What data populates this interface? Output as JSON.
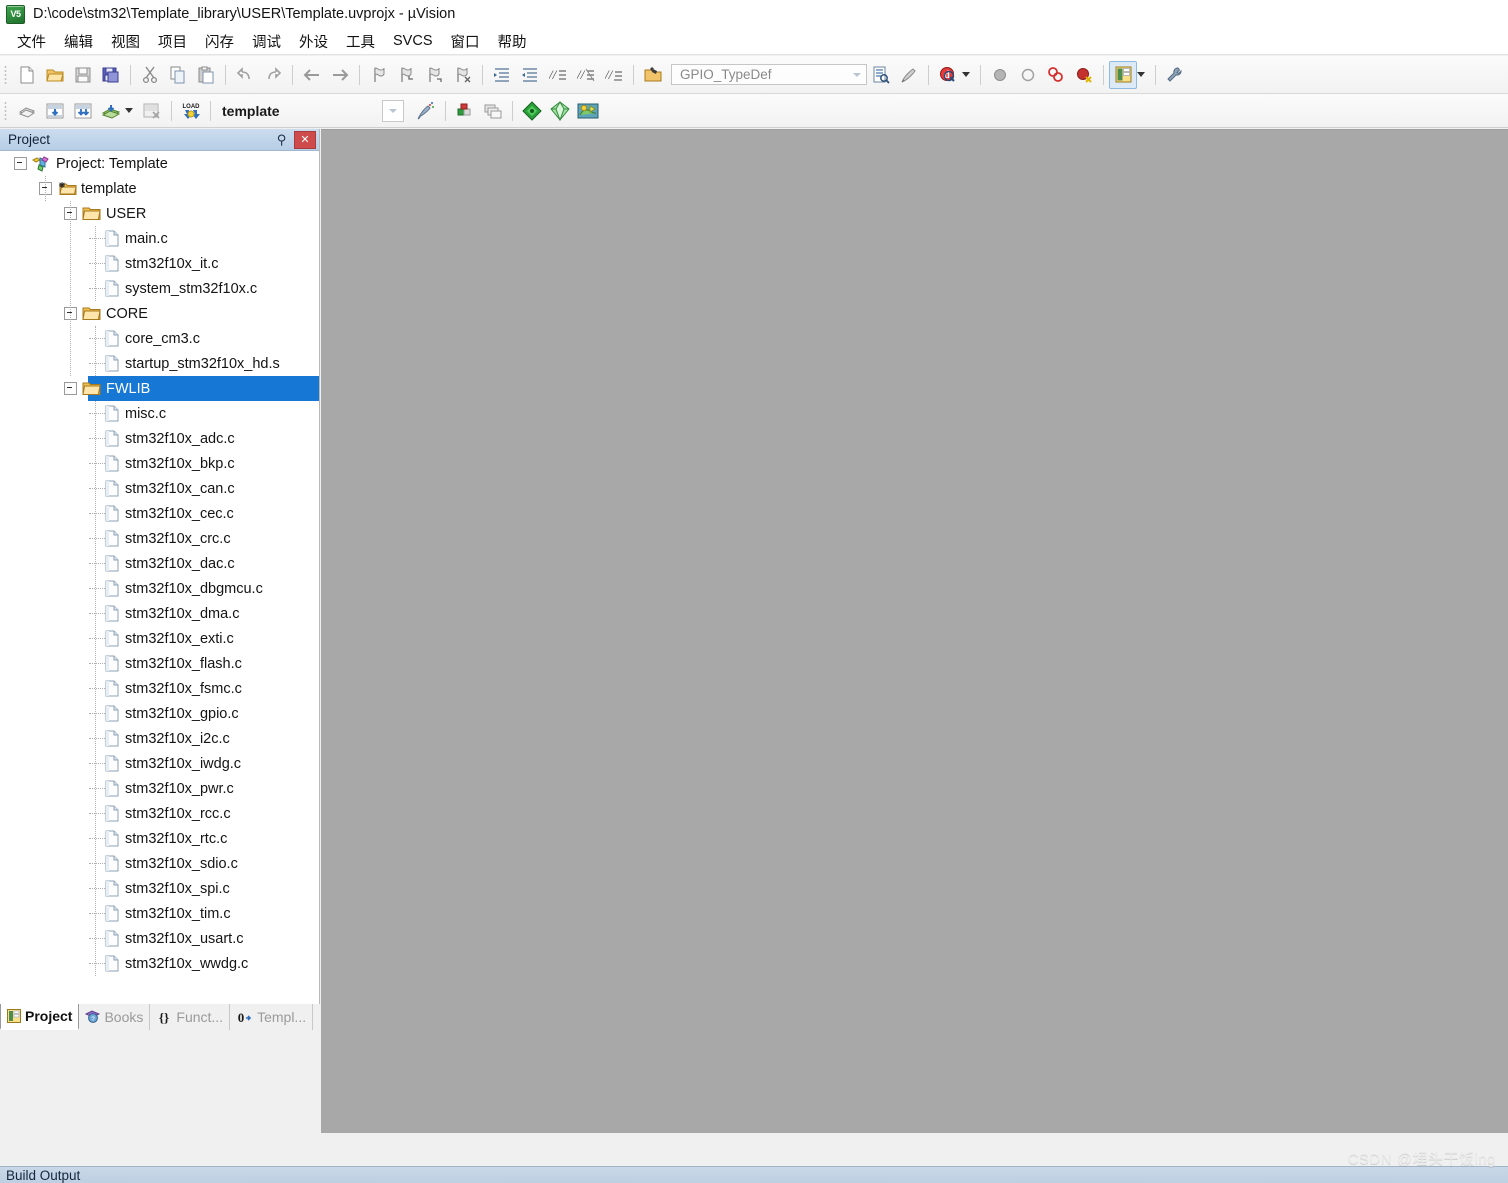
{
  "window": {
    "title": "D:\\code\\stm32\\Template_library\\USER\\Template.uvprojx - µVision",
    "app_icon_label": "V5"
  },
  "menubar": {
    "items": [
      {
        "label": "文件"
      },
      {
        "label": "编辑"
      },
      {
        "label": "视图"
      },
      {
        "label": "项目"
      },
      {
        "label": "闪存"
      },
      {
        "label": "调试"
      },
      {
        "label": "外设"
      },
      {
        "label": "工具"
      },
      {
        "label": "SVCS"
      },
      {
        "label": "窗口"
      },
      {
        "label": "帮助"
      }
    ]
  },
  "toolbar_main": {
    "symbol_combo_value": "GPIO_TypeDef"
  },
  "toolbar_build": {
    "target_value": "template"
  },
  "project_panel": {
    "title": "Project",
    "pin_glyph": "⚲",
    "close_glyph": "✕",
    "tree": [
      {
        "label": "Project: Template",
        "type": "project",
        "depth": 0,
        "expanded": true,
        "selected": false
      },
      {
        "label": "template",
        "type": "target",
        "depth": 1,
        "expanded": true,
        "selected": false
      },
      {
        "label": "USER",
        "type": "folder",
        "depth": 2,
        "expanded": true,
        "selected": false
      },
      {
        "label": "main.c",
        "type": "file",
        "depth": 3,
        "expanded": false,
        "selected": false
      },
      {
        "label": "stm32f10x_it.c",
        "type": "file",
        "depth": 3,
        "expanded": false,
        "selected": false
      },
      {
        "label": "system_stm32f10x.c",
        "type": "file",
        "depth": 3,
        "expanded": false,
        "selected": false
      },
      {
        "label": "CORE",
        "type": "folder",
        "depth": 2,
        "expanded": true,
        "selected": false
      },
      {
        "label": "core_cm3.c",
        "type": "file",
        "depth": 3,
        "expanded": false,
        "selected": false
      },
      {
        "label": "startup_stm32f10x_hd.s",
        "type": "file",
        "depth": 3,
        "expanded": false,
        "selected": false
      },
      {
        "label": "FWLIB",
        "type": "folder",
        "depth": 2,
        "expanded": true,
        "selected": true
      },
      {
        "label": "misc.c",
        "type": "file",
        "depth": 3,
        "expanded": false,
        "selected": false
      },
      {
        "label": "stm32f10x_adc.c",
        "type": "file",
        "depth": 3,
        "expanded": false,
        "selected": false
      },
      {
        "label": "stm32f10x_bkp.c",
        "type": "file",
        "depth": 3,
        "expanded": false,
        "selected": false
      },
      {
        "label": "stm32f10x_can.c",
        "type": "file",
        "depth": 3,
        "expanded": false,
        "selected": false
      },
      {
        "label": "stm32f10x_cec.c",
        "type": "file",
        "depth": 3,
        "expanded": false,
        "selected": false
      },
      {
        "label": "stm32f10x_crc.c",
        "type": "file",
        "depth": 3,
        "expanded": false,
        "selected": false
      },
      {
        "label": "stm32f10x_dac.c",
        "type": "file",
        "depth": 3,
        "expanded": false,
        "selected": false
      },
      {
        "label": "stm32f10x_dbgmcu.c",
        "type": "file",
        "depth": 3,
        "expanded": false,
        "selected": false
      },
      {
        "label": "stm32f10x_dma.c",
        "type": "file",
        "depth": 3,
        "expanded": false,
        "selected": false
      },
      {
        "label": "stm32f10x_exti.c",
        "type": "file",
        "depth": 3,
        "expanded": false,
        "selected": false
      },
      {
        "label": "stm32f10x_flash.c",
        "type": "file",
        "depth": 3,
        "expanded": false,
        "selected": false
      },
      {
        "label": "stm32f10x_fsmc.c",
        "type": "file",
        "depth": 3,
        "expanded": false,
        "selected": false
      },
      {
        "label": "stm32f10x_gpio.c",
        "type": "file",
        "depth": 3,
        "expanded": false,
        "selected": false
      },
      {
        "label": "stm32f10x_i2c.c",
        "type": "file",
        "depth": 3,
        "expanded": false,
        "selected": false
      },
      {
        "label": "stm32f10x_iwdg.c",
        "type": "file",
        "depth": 3,
        "expanded": false,
        "selected": false
      },
      {
        "label": "stm32f10x_pwr.c",
        "type": "file",
        "depth": 3,
        "expanded": false,
        "selected": false
      },
      {
        "label": "stm32f10x_rcc.c",
        "type": "file",
        "depth": 3,
        "expanded": false,
        "selected": false
      },
      {
        "label": "stm32f10x_rtc.c",
        "type": "file",
        "depth": 3,
        "expanded": false,
        "selected": false
      },
      {
        "label": "stm32f10x_sdio.c",
        "type": "file",
        "depth": 3,
        "expanded": false,
        "selected": false
      },
      {
        "label": "stm32f10x_spi.c",
        "type": "file",
        "depth": 3,
        "expanded": false,
        "selected": false
      },
      {
        "label": "stm32f10x_tim.c",
        "type": "file",
        "depth": 3,
        "expanded": false,
        "selected": false
      },
      {
        "label": "stm32f10x_usart.c",
        "type": "file",
        "depth": 3,
        "expanded": false,
        "selected": false
      },
      {
        "label": "stm32f10x_wwdg.c",
        "type": "file",
        "depth": 3,
        "expanded": false,
        "selected": false
      }
    ]
  },
  "bottom_tabs": [
    {
      "label": "Project",
      "icon": "project-window-icon",
      "active": true
    },
    {
      "label": "Books",
      "icon": "books-icon",
      "active": false
    },
    {
      "label": "Funct...",
      "icon": "functions-icon",
      "active": false
    },
    {
      "label": "Templ...",
      "icon": "templates-icon",
      "active": false
    }
  ],
  "build_output": {
    "label": "Build Output"
  },
  "watermark": {
    "text": "CSDN @埋头干饭ing"
  },
  "colors": {
    "selection": "#1678d4",
    "panel_header": "#bdd4ea",
    "editor_background": "#a8a8a8",
    "close_button": "#cf4b4b"
  }
}
